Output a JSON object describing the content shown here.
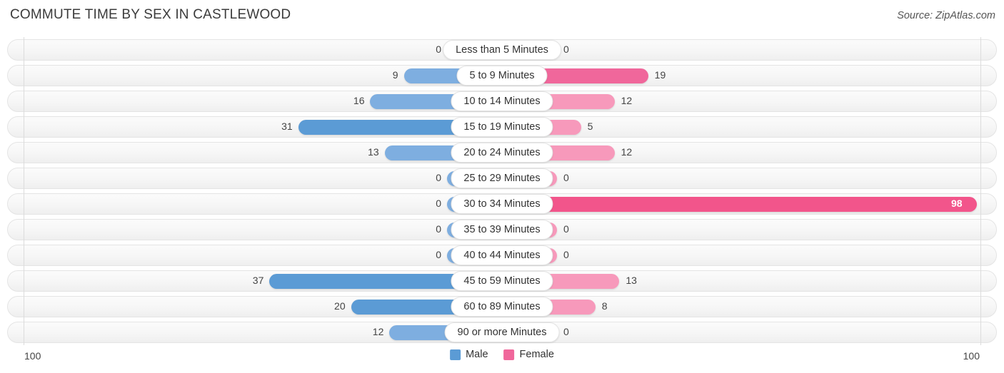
{
  "header": {
    "title": "COMMUTE TIME BY SEX IN CASTLEWOOD",
    "source": "Source: ZipAtlas.com"
  },
  "legend": {
    "male": {
      "label": "Male",
      "color": "#5B9BD5"
    },
    "female": {
      "label": "Female",
      "color": "#F0679B"
    }
  },
  "axis": {
    "left_max": "100",
    "right_max": "100"
  },
  "chart_data": {
    "type": "bar",
    "title": "COMMUTE TIME BY SEX IN CASTLEWOOD",
    "orientation": "horizontal-diverging",
    "xlabel": "",
    "ylabel": "",
    "xlim": [
      0,
      100
    ],
    "grid": false,
    "legend_position": "bottom-center",
    "categories": [
      "Less than 5 Minutes",
      "5 to 9 Minutes",
      "10 to 14 Minutes",
      "15 to 19 Minutes",
      "20 to 24 Minutes",
      "25 to 29 Minutes",
      "30 to 34 Minutes",
      "35 to 39 Minutes",
      "40 to 44 Minutes",
      "45 to 59 Minutes",
      "60 to 89 Minutes",
      "90 or more Minutes"
    ],
    "series": [
      {
        "name": "Male",
        "values": [
          0,
          9,
          16,
          31,
          13,
          0,
          0,
          0,
          0,
          37,
          20,
          12
        ]
      },
      {
        "name": "Female",
        "values": [
          0,
          19,
          12,
          5,
          12,
          0,
          98,
          0,
          0,
          13,
          8,
          0
        ]
      }
    ]
  },
  "rows": [
    {
      "label": "Less than 5 Minutes",
      "male": "0",
      "female": "0"
    },
    {
      "label": "5 to 9 Minutes",
      "male": "9",
      "female": "19"
    },
    {
      "label": "10 to 14 Minutes",
      "male": "16",
      "female": "12"
    },
    {
      "label": "15 to 19 Minutes",
      "male": "31",
      "female": "5"
    },
    {
      "label": "20 to 24 Minutes",
      "male": "13",
      "female": "12"
    },
    {
      "label": "25 to 29 Minutes",
      "male": "0",
      "female": "0"
    },
    {
      "label": "30 to 34 Minutes",
      "male": "0",
      "female": "98"
    },
    {
      "label": "35 to 39 Minutes",
      "male": "0",
      "female": "0"
    },
    {
      "label": "40 to 44 Minutes",
      "male": "0",
      "female": "0"
    },
    {
      "label": "45 to 59 Minutes",
      "male": "37",
      "female": "13"
    },
    {
      "label": "60 to 89 Minutes",
      "male": "20",
      "female": "8"
    },
    {
      "label": "90 or more Minutes",
      "male": "12",
      "female": "0"
    }
  ]
}
